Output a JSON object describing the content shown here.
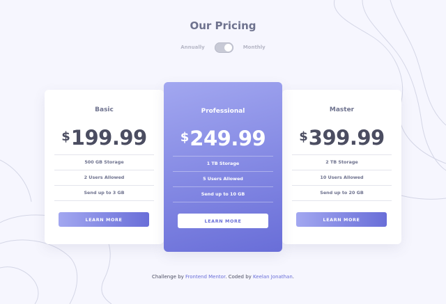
{
  "title": "Our Pricing",
  "billing_toggle": {
    "left_label": "Annually",
    "right_label": "Monthly"
  },
  "plans": [
    {
      "name": "Basic",
      "currency": "$",
      "price": "199.99",
      "features": [
        "500 GB Storage",
        "2 Users Allowed",
        "Send up to 3 GB"
      ],
      "button_label": "LEARN MORE"
    },
    {
      "name": "Professional",
      "currency": "$",
      "price": "249.99",
      "features": [
        "1 TB Storage",
        "5 Users Allowed",
        "Send up to 10 GB"
      ],
      "button_label": "LEARN MORE"
    },
    {
      "name": "Master",
      "currency": "$",
      "price": "399.99",
      "features": [
        "2 TB Storage",
        "10 Users Allowed",
        "Send up to 20 GB"
      ],
      "button_label": "LEARN MORE"
    }
  ],
  "footer": {
    "prefix": "Challenge by ",
    "link1": "Frontend Mentor",
    "middle": ". Coded by ",
    "link2": "Keelan Jonathan",
    "suffix": "."
  },
  "colors": {
    "accent_start": "#a2a7f0",
    "accent_end": "#696ed8",
    "background": "#f6f6fe",
    "heading": "#6e728e",
    "price": "#4b4d61"
  }
}
